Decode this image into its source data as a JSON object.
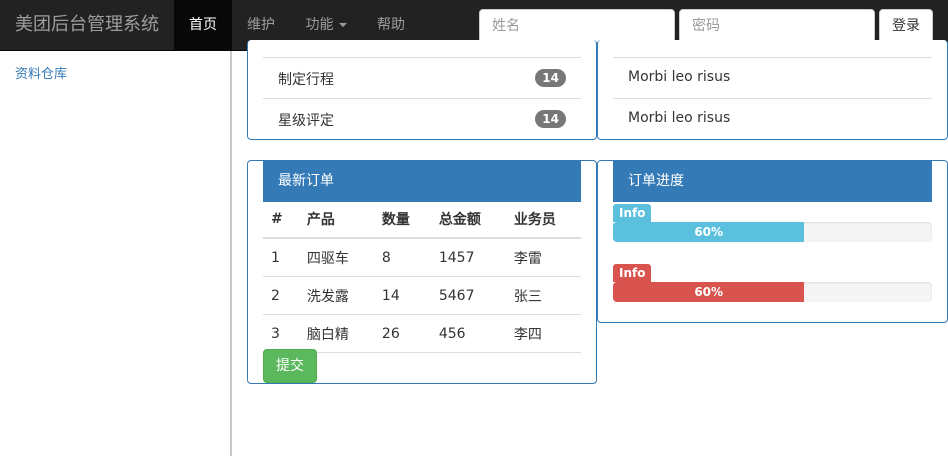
{
  "colors": {
    "navbar_bg": "#222222",
    "primary": "#337ab7",
    "success": "#5cb85c",
    "info": "#5bc0de",
    "danger": "#d9534f",
    "badge": "#777777"
  },
  "navbar": {
    "brand": "美团后台管理系统",
    "items": [
      {
        "label": "首页",
        "active": true
      },
      {
        "label": "维护",
        "active": false
      },
      {
        "label": "功能",
        "active": false,
        "dropdown": true,
        "icon": "caret-down-icon"
      },
      {
        "label": "帮助",
        "active": false
      }
    ],
    "name_placeholder": "姓名",
    "password_placeholder": "密码",
    "login_label": "登录"
  },
  "sidebar": {
    "items": [
      {
        "label": "资料仓库"
      }
    ]
  },
  "schedule_panel": {
    "items": [
      {
        "label": "制定行程",
        "badge": "14"
      },
      {
        "label": "星级评定",
        "badge": "14"
      }
    ]
  },
  "text_panel": {
    "items": [
      {
        "label": "Morbi leo risus"
      },
      {
        "label": "Morbi leo risus"
      }
    ]
  },
  "orders_panel": {
    "title": "最新订单",
    "columns": [
      "#",
      "产品",
      "数量",
      "总金额",
      "业务员"
    ],
    "rows": [
      [
        "1",
        "四驱车",
        "8",
        "1457",
        "李雷"
      ],
      [
        "2",
        "洗发露",
        "14",
        "5467",
        "张三"
      ],
      [
        "3",
        "脑白精",
        "26",
        "456",
        "李四"
      ]
    ],
    "submit_label": "提交"
  },
  "progress_panel": {
    "title": "订单进度",
    "bars": [
      {
        "tag": "Info",
        "text": "60%",
        "percent": 60,
        "color": "#5bc0de"
      },
      {
        "tag": "Info",
        "text": "60%",
        "percent": 60,
        "color": "#d9534f"
      }
    ]
  }
}
